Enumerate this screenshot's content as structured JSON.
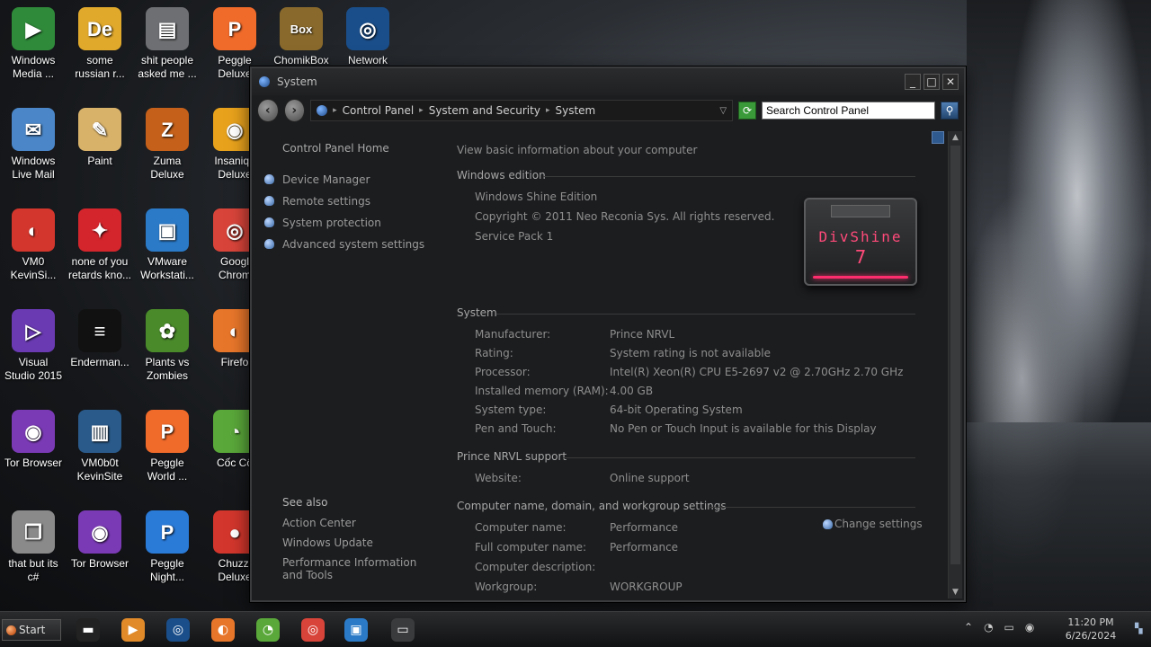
{
  "desktop": {
    "icons": [
      {
        "name": "windows-media-player-icon",
        "label": "Windows\nMedia ...",
        "glyph": "▶",
        "color": "#2f8a3a"
      },
      {
        "name": "some-russian-icon",
        "label": "some\nrussian r...",
        "glyph": "De",
        "color": "#e1a92c"
      },
      {
        "name": "folder-shit-people-icon",
        "label": "shit people\nasked me ...",
        "glyph": "▤",
        "color": "#6d6f72"
      },
      {
        "name": "peggle-deluxe-icon",
        "label": "Peggle\nDeluxe",
        "glyph": "P",
        "color": "#f06a2a"
      },
      {
        "name": "chomikbox-icon",
        "label": "ChomikBox",
        "glyph": "Box",
        "color": "#8a6a2c"
      },
      {
        "name": "network-icon",
        "label": "Network",
        "glyph": "◎",
        "color": "#1a4e8a"
      },
      {
        "name": "windows-live-mail-icon",
        "label": "Windows\nLive Mail",
        "glyph": "✉",
        "color": "#4a86c8"
      },
      {
        "name": "paint-icon",
        "label": "Paint",
        "glyph": "✎",
        "color": "#d9b26a"
      },
      {
        "name": "zuma-deluxe-icon",
        "label": "Zuma\nDeluxe",
        "glyph": "Z",
        "color": "#c4601a"
      },
      {
        "name": "insaniquarium-icon",
        "label": "Insaniqu\nDeluxe",
        "glyph": "◉",
        "color": "#e8a21c"
      },
      {
        "name": "vm0-kevinsite-icon",
        "label": "VM0\nKevinSi...",
        "glyph": "◐",
        "color": "#d3362c"
      },
      {
        "name": "none-of-you-icon",
        "label": "none of you\nretards kno...",
        "glyph": "✦",
        "color": "#d4252c"
      },
      {
        "name": "vmware-workstation-icon",
        "label": "VMware\nWorkstati...",
        "glyph": "▣",
        "color": "#2a7ac8"
      },
      {
        "name": "google-chrome-icon",
        "label": "Googl\nChrom",
        "glyph": "◎",
        "color": "#d8443a"
      },
      {
        "name": "visual-studio-icon",
        "label": "Visual\nStudio 2015",
        "glyph": "▷",
        "color": "#6a3ab3"
      },
      {
        "name": "enderman-icon",
        "label": "Enderman...",
        "glyph": "≡",
        "color": "#111111"
      },
      {
        "name": "plants-vs-zombies-icon",
        "label": "Plants vs\nZombies",
        "glyph": "✿",
        "color": "#4a8a2a"
      },
      {
        "name": "firefox-icon",
        "label": "Firefo",
        "glyph": "◐",
        "color": "#e8762a"
      },
      {
        "name": "tor-browser-icon",
        "label": "Tor Browser",
        "glyph": "◉",
        "color": "#7a3ab5"
      },
      {
        "name": "vm0b0t-kevinsite-icon",
        "label": "VM0b0t\nKevinSite",
        "glyph": "▥",
        "color": "#2a5a8a"
      },
      {
        "name": "peggle-world-icon",
        "label": "Peggle\nWorld ...",
        "glyph": "P",
        "color": "#f06a2a"
      },
      {
        "name": "coc-coc-icon",
        "label": "Cốc Cố",
        "glyph": "◔",
        "color": "#5aa83a"
      },
      {
        "name": "that-but-its-csharp-icon",
        "label": "that but its\nc#",
        "glyph": "❐",
        "color": "#8a8a8a"
      },
      {
        "name": "tor-browser-2-icon",
        "label": "Tor Browser",
        "glyph": "◉",
        "color": "#7a3ab5"
      },
      {
        "name": "peggle-nights-icon",
        "label": "Peggle\nNight...",
        "glyph": "P",
        "color": "#2a7ad8"
      },
      {
        "name": "chuzzle-deluxe-icon",
        "label": "Chuzzl\nDeluxe",
        "glyph": "●",
        "color": "#d3362c"
      }
    ]
  },
  "window": {
    "title": "System",
    "buttons": {
      "minimize": "_",
      "maximize": "□",
      "close": "✕"
    },
    "breadcrumb": [
      "Control Panel",
      "System and Security",
      "System"
    ],
    "search_value": "Search Control Panel"
  },
  "leftpane": {
    "home": "Control Panel Home",
    "tasks": [
      "Device Manager",
      "Remote settings",
      "System protection",
      "Advanced system settings"
    ],
    "see_also_title": "See also",
    "see_also": [
      "Action Center",
      "Windows Update",
      "Performance Information and Tools"
    ]
  },
  "main": {
    "heading": "View basic information about your computer",
    "edition_title": "Windows edition",
    "edition_lines": [
      "Windows Shine Edition",
      "Copyright © 2011 Neo Reconia Sys.  All rights reserved.",
      "Service Pack 1"
    ],
    "logo_brand": "DivShine",
    "logo_version": "7",
    "system_title": "System",
    "system_rows": [
      {
        "label": "Manufacturer:",
        "value": "Prince NRVL"
      },
      {
        "label": "Rating:",
        "value": "System rating is not available"
      },
      {
        "label": "Processor:",
        "value": "Intel(R) Xeon(R) CPU E5-2697 v2 @ 2.70GHz   2.70 GHz"
      },
      {
        "label": "Installed memory (RAM):",
        "value": "4.00 GB"
      },
      {
        "label": "System type:",
        "value": "64-bit Operating System"
      },
      {
        "label": "Pen and Touch:",
        "value": "No Pen or Touch Input is available for this Display"
      }
    ],
    "support_title": "Prince NRVL support",
    "support_rows": [
      {
        "label": "Website:",
        "value": "Online support"
      }
    ],
    "computer_title": "Computer name, domain, and workgroup settings",
    "change_settings": "Change settings",
    "computer_rows": [
      {
        "label": "Computer name:",
        "value": "Performance"
      },
      {
        "label": "Full computer name:",
        "value": "Performance"
      },
      {
        "label": "Computer description:",
        "value": ""
      },
      {
        "label": "Workgroup:",
        "value": "WORKGROUP"
      }
    ]
  },
  "taskbar": {
    "start_label": "Start",
    "items": [
      {
        "name": "taskbar-app-1-icon",
        "glyph": "▬",
        "color": "#222"
      },
      {
        "name": "taskbar-media-player-icon",
        "glyph": "▶",
        "color": "#e08a2a"
      },
      {
        "name": "taskbar-globe-icon",
        "glyph": "◎",
        "color": "#1a4e8a"
      },
      {
        "name": "taskbar-firefox-icon",
        "glyph": "◐",
        "color": "#e8762a"
      },
      {
        "name": "taskbar-coc-coc-icon",
        "glyph": "◔",
        "color": "#5aa83a"
      },
      {
        "name": "taskbar-chrome-icon",
        "glyph": "◎",
        "color": "#d8443a"
      },
      {
        "name": "taskbar-vmware-icon",
        "glyph": "▣",
        "color": "#2a7ac8"
      },
      {
        "name": "taskbar-system-window-icon",
        "glyph": "▭",
        "color": "#3a3b3d"
      }
    ],
    "time": "11:20 PM",
    "date": "6/26/2024"
  }
}
